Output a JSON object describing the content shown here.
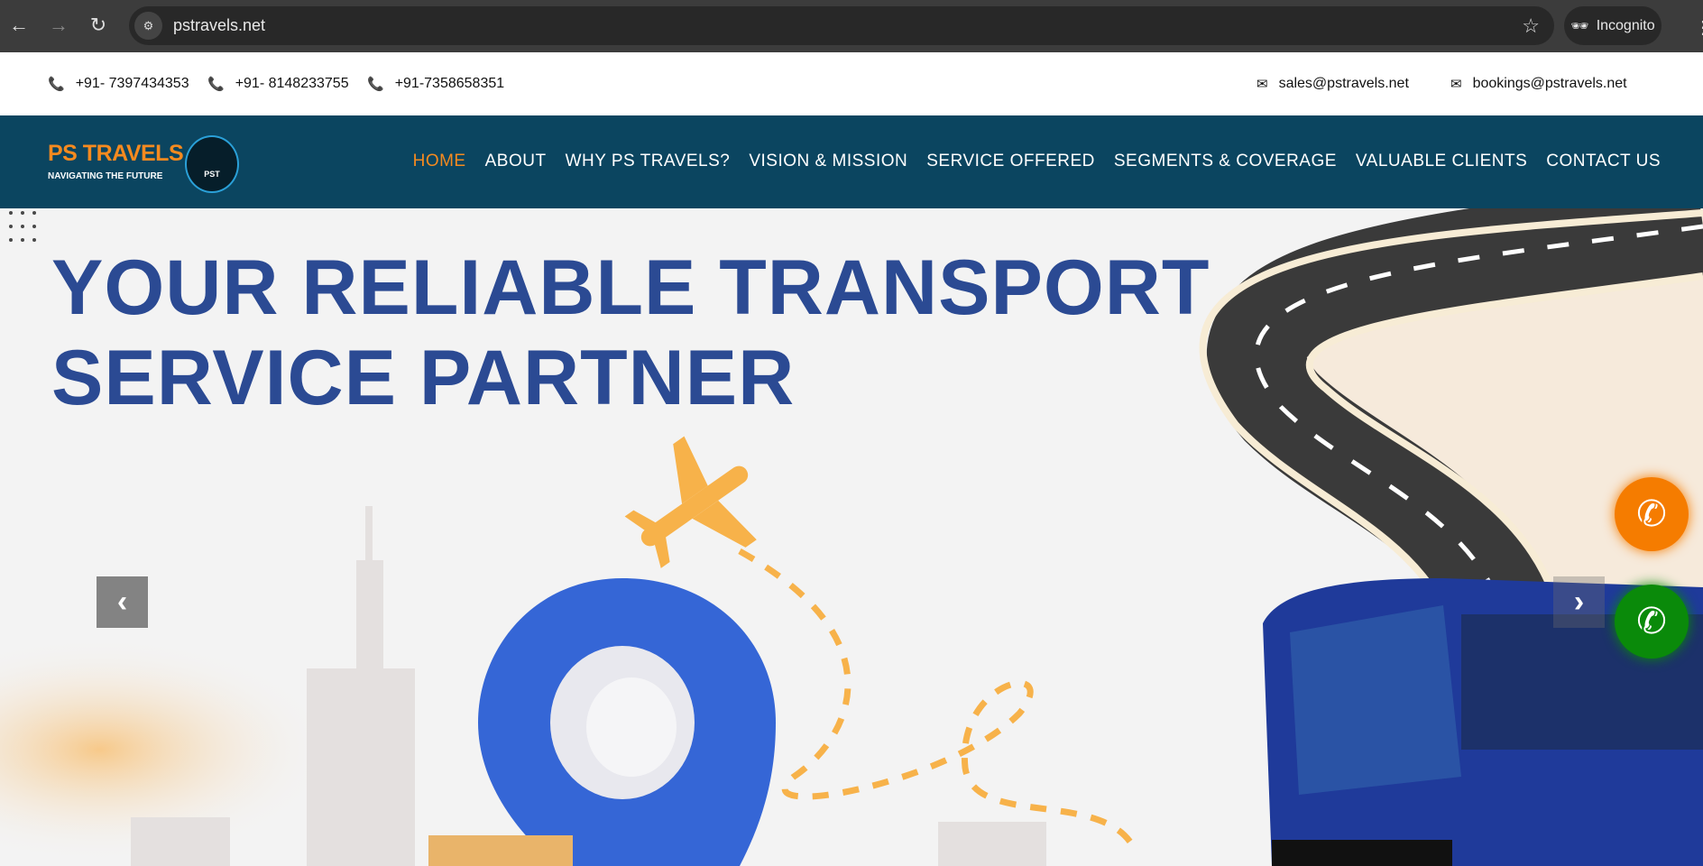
{
  "browser": {
    "url": "pstravels.net",
    "incognito_label": "Incognito"
  },
  "topbar": {
    "phones": [
      "+91- 7397434353",
      "+91- 8148233755",
      "+91-7358658351"
    ],
    "emails": [
      "sales@pstravels.net",
      "bookings@pstravels.net"
    ]
  },
  "header": {
    "brand": "PS TRAVELS",
    "tagline": "NAVIGATING THE FUTURE",
    "logo_text": "PST",
    "menu": [
      {
        "label": "HOME",
        "active": true
      },
      {
        "label": "ABOUT"
      },
      {
        "label": "WHY PS TRAVELS?"
      },
      {
        "label": "VISION & MISSION"
      },
      {
        "label": "SERVICE OFFERED"
      },
      {
        "label": "SEGMENTS & COVERAGE"
      },
      {
        "label": "VALUABLE CLIENTS"
      },
      {
        "label": "CONTACT US"
      }
    ]
  },
  "hero": {
    "headline_line1": "YOUR RELIABLE TRANSPORT",
    "headline_line2": "SERVICE PARTNER"
  },
  "colors": {
    "nav_bg": "#0b4560",
    "accent": "#f58a1f",
    "headline": "#2b4a93",
    "call": "#f57c00",
    "whatsapp": "#0a8a0a"
  }
}
